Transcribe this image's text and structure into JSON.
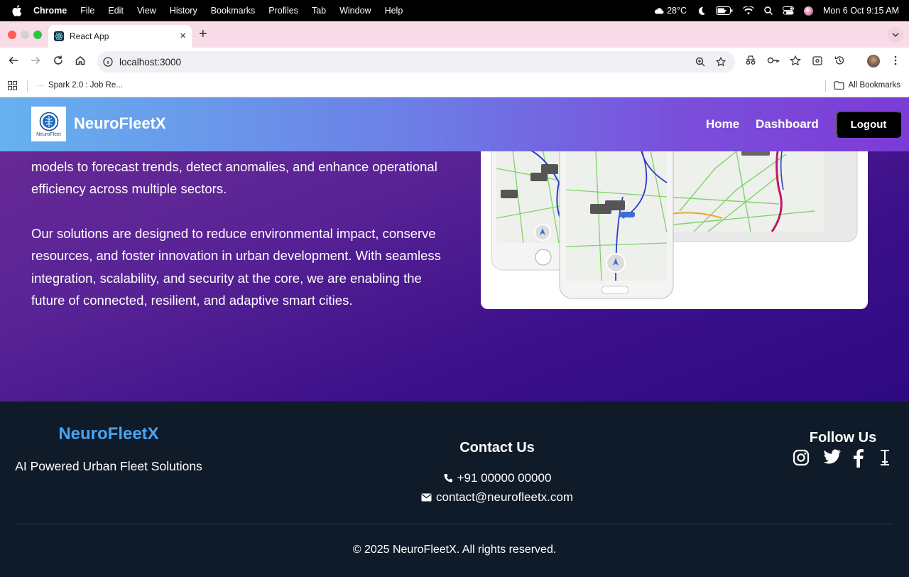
{
  "menubar": {
    "app_name": "Chrome",
    "items": [
      "File",
      "Edit",
      "View",
      "History",
      "Bookmarks",
      "Profiles",
      "Tab",
      "Window",
      "Help"
    ],
    "weather": "28°C",
    "datetime": "Mon 6 Oct  9:15 AM"
  },
  "browser": {
    "tab_title": "React App",
    "url": "localhost:3000",
    "bookmark_item": "Spark 2.0 : Job Re...",
    "all_bookmarks": "All Bookmarks"
  },
  "navbar": {
    "logo_text": "NeuroFleet",
    "brand": "NeuroFleetX",
    "links": [
      "Home",
      "Dashboard"
    ],
    "logout_label": "Logout"
  },
  "about": {
    "paragraphs": [
      "make data-driven decisions. We leverage advanced machine learning models to forecast trends, detect anomalies, and enhance operational efficiency across multiple sectors.",
      "Our solutions are designed to reduce environmental impact, conserve resources, and foster innovation in urban development. With seamless integration, scalability, and security at the core, we are enabling the future of connected, resilient, and adaptive smart cities."
    ]
  },
  "footer": {
    "brand": "NeuroFleetX",
    "tagline": "AI Powered Urban Fleet Solutions",
    "contact_title": "Contact Us",
    "phone": "+91 00000 00000",
    "email": "contact@neurofleetx.com",
    "follow_title": "Follow Us",
    "social_icons": [
      "instagram-icon",
      "twitter-icon",
      "facebook-icon",
      "text-cursor-icon"
    ],
    "copyright": "© 2025 NeuroFleetX. All rights reserved."
  },
  "colors": {
    "navbar_start": "#67b1ef",
    "navbar_end": "#7c3bd6",
    "hero_bg": "#3a0f8a",
    "footer_bg": "#101b29",
    "footer_brand": "#4aa3ef"
  }
}
